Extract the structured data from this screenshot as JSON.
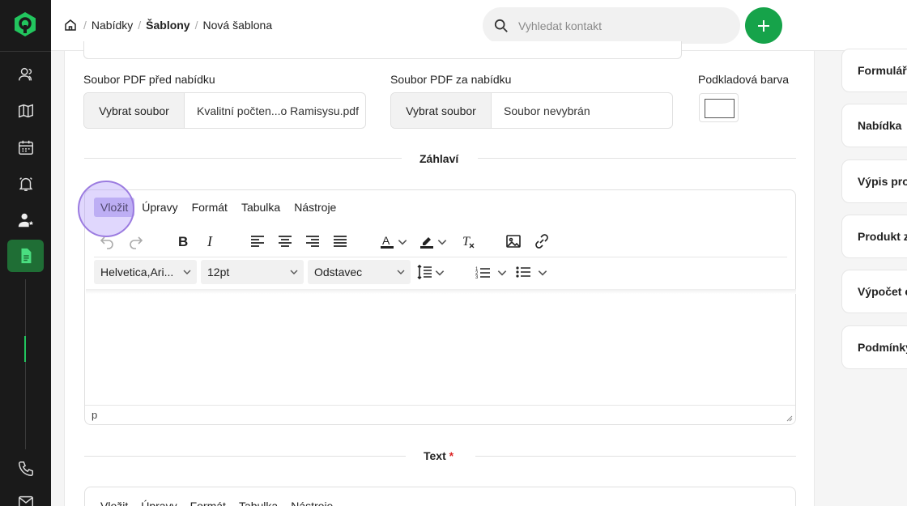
{
  "breadcrumb": {
    "items": [
      "Nabídky",
      "Šablony",
      "Nová šablona"
    ]
  },
  "search": {
    "placeholder": "Vyhledat kontakt"
  },
  "form": {
    "pdf_before": {
      "label": "Soubor PDF před nabídku",
      "button": "Vybrat soubor",
      "file": "Kvalitní počten...o Ramisysu.pdf"
    },
    "pdf_after": {
      "label": "Soubor PDF za nabídku",
      "button": "Vybrat soubor",
      "file": "Soubor nevybrán"
    },
    "bg_color": {
      "label": "Podkladová barva",
      "value": "#ffffff"
    }
  },
  "header_section": {
    "title": "Záhlaví"
  },
  "editor": {
    "menu": [
      "Vložit",
      "Úpravy",
      "Formát",
      "Tabulka",
      "Nástroje"
    ],
    "font_family": "Helvetica,Ari...",
    "font_size": "12pt",
    "block_format": "Odstavec",
    "status_path": "p"
  },
  "text_section": {
    "title": "Text",
    "required_mark": "*"
  },
  "editor2": {
    "menu": [
      "Vložit",
      "Úpravy",
      "Formát",
      "Tabulka",
      "Nástroje"
    ]
  },
  "right_panel": {
    "items": [
      "Formuláře",
      "Nabídka",
      "Výpis pro",
      "Produkt z",
      "Výpočet c",
      "Podmínky"
    ]
  },
  "colors": {
    "accent": "#16a34a",
    "sidebar": "#1a1a1a",
    "highlight": "#c9c0f2"
  },
  "sidebar": {
    "icons": [
      "contacts-icon",
      "map-icon",
      "calendar-icon",
      "bell-icon",
      "users-icon",
      "document-icon",
      "phone-icon",
      "mail-icon"
    ]
  }
}
